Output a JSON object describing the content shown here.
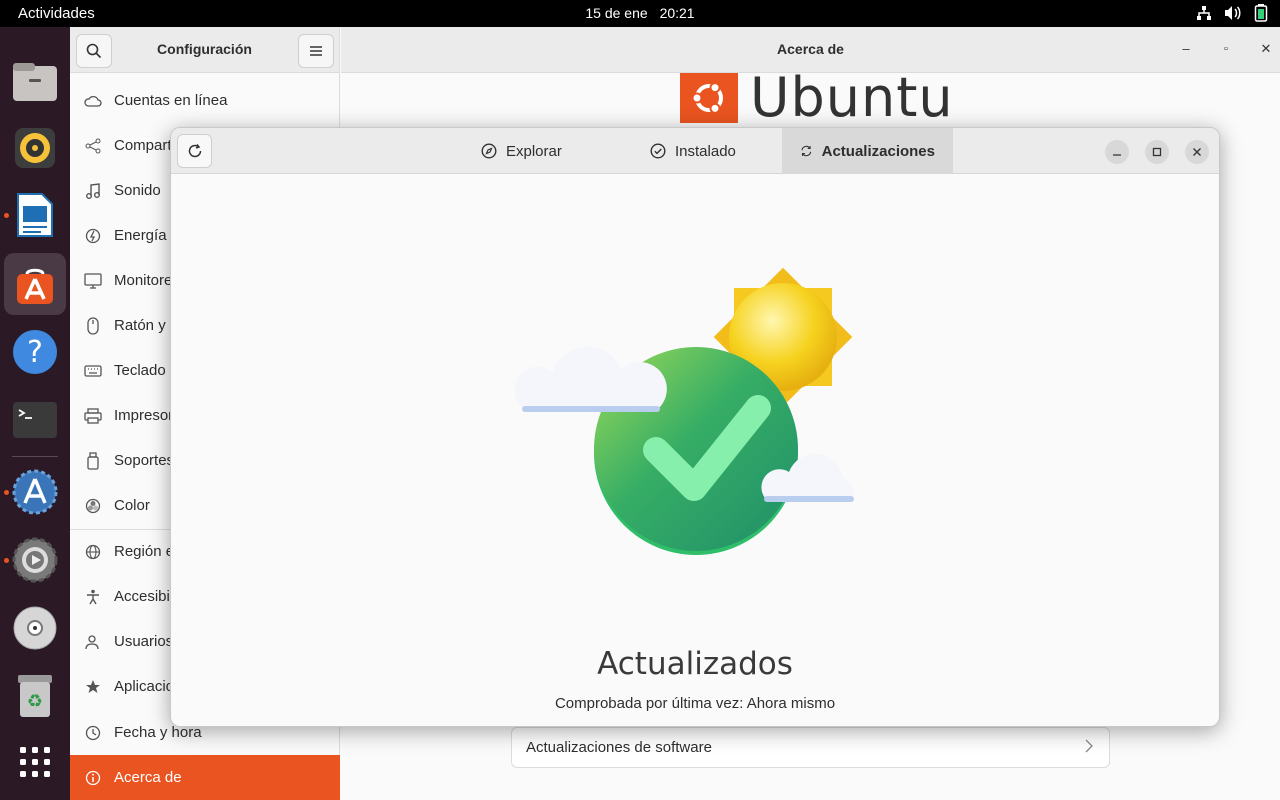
{
  "topbar": {
    "activities": "Actividades",
    "date": "15 de ene",
    "time": "20:21",
    "tray_icons": [
      "network-icon",
      "volume-icon",
      "battery-icon"
    ]
  },
  "dock": {
    "items": [
      "files-icon",
      "rhythmbox-icon",
      "writer-icon",
      "software-icon",
      "help-icon",
      "terminal-icon",
      "updater-icon",
      "settings-app-icon",
      "disc-icon",
      "trash-icon",
      "app-grid-icon"
    ]
  },
  "settings": {
    "sidebar_title": "Configuración",
    "window_title": "Acerca de",
    "sidebar_items": [
      {
        "label": "Cuentas en línea",
        "icon": "cloud-icon"
      },
      {
        "label": "Compartir",
        "icon": "share-icon"
      },
      {
        "label": "Sonido",
        "icon": "music-note-icon"
      },
      {
        "label": "Energía",
        "icon": "power-icon"
      },
      {
        "label": "Monitores",
        "icon": "monitor-icon"
      },
      {
        "label": "Ratón y panel táctil",
        "icon": "mouse-icon"
      },
      {
        "label": "Teclado",
        "icon": "keyboard-icon"
      },
      {
        "label": "Impresoras",
        "icon": "printer-icon"
      },
      {
        "label": "Soportes extraíbles",
        "icon": "removable-media-icon"
      },
      {
        "label": "Color",
        "icon": "color-icon"
      },
      {
        "label": "Región e idioma",
        "icon": "globe-icon"
      },
      {
        "label": "Accesibilidad",
        "icon": "accessibility-icon"
      },
      {
        "label": "Usuarios",
        "icon": "users-icon"
      },
      {
        "label": "Aplicaciones predeterminadas",
        "icon": "star-icon"
      },
      {
        "label": "Fecha y hora",
        "icon": "clock-icon"
      },
      {
        "label": "Acerca de",
        "icon": "info-icon"
      }
    ],
    "about": {
      "logo_word": "Ubuntu",
      "software_updates_row": "Actualizaciones de software"
    }
  },
  "software": {
    "tabs": [
      {
        "label": "Explorar",
        "icon": "compass-icon"
      },
      {
        "label": "Instalado",
        "icon": "check-circle-icon"
      },
      {
        "label": "Actualizaciones",
        "icon": "sync-icon"
      }
    ],
    "active_tab": "Actualizaciones",
    "status_title": "Actualizados",
    "status_subtitle": "Comprobada por última vez: Ahora mismo",
    "colors": {
      "accent": "#e95420",
      "check_green": "#2ea36a",
      "sun": "#f6d21f"
    }
  }
}
